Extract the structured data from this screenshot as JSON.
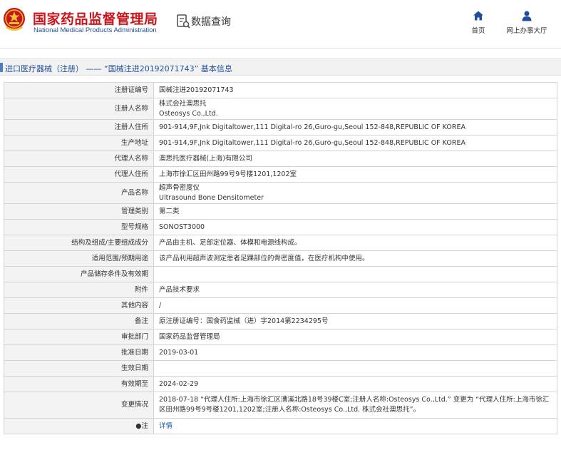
{
  "header": {
    "site_name_cn": "国家药品监督管理局",
    "site_name_en": "National Medical Products Administration",
    "section_label": "数据查询",
    "nav": [
      {
        "label": "首页",
        "icon": "home-icon"
      },
      {
        "label": "网上办事大厅",
        "icon": "user-icon"
      }
    ]
  },
  "page": {
    "title": "进口医疗器械（注册） —— “国械注进20192071743” 基本信息"
  },
  "details": [
    {
      "label": "注册证编号",
      "lines": [
        "国械注进20192071743"
      ]
    },
    {
      "label": "注册人名称",
      "lines": [
        "株式会社澳思托",
        "Osteosys Co.,Ltd."
      ]
    },
    {
      "label": "注册人住所",
      "lines": [
        "901-914,9F,Jnk Digitaltower,111 Digital-ro 26,Guro-gu,Seoul 152-848,REPUBLIC OF KOREA"
      ]
    },
    {
      "label": "生产地址",
      "lines": [
        "901-914,9F,Jnk Digitaltower,111 Digital-ro 26,Guro-gu,Seoul 152-848,REPUBLIC OF KOREA"
      ]
    },
    {
      "label": "代理人名称",
      "lines": [
        "澳思托医疗器械(上海)有限公司"
      ]
    },
    {
      "label": "代理人住所",
      "lines": [
        "上海市徐汇区田州路99号9号楼1201,1202室"
      ]
    },
    {
      "label": "产品名称",
      "lines": [
        "超声骨密度仪",
        "Ultrasound Bone Densitometer"
      ]
    },
    {
      "label": "管理类别",
      "lines": [
        "第二类"
      ]
    },
    {
      "label": "型号规格",
      "lines": [
        "SONOST3000"
      ]
    },
    {
      "label": "结构及组成/主要组成成分",
      "lines": [
        "产品由主机、足部定位器、体模和电源线构成。"
      ]
    },
    {
      "label": "适用范围/预期用途",
      "lines": [
        "该产品利用超声波测定患者足踝部位的骨密度值，在医疗机构中使用。"
      ]
    },
    {
      "label": "产品储存条件及有效期",
      "lines": [
        ""
      ]
    },
    {
      "label": "附件",
      "lines": [
        "产品技术要求"
      ]
    },
    {
      "label": "其他内容",
      "lines": [
        "/"
      ]
    },
    {
      "label": "备注",
      "lines": [
        "原注册证编号：国食药监械（进）字2014第2234295号"
      ]
    },
    {
      "label": "审批部门",
      "lines": [
        "国家药品监督管理局"
      ]
    },
    {
      "label": "批准日期",
      "lines": [
        "2019-03-01"
      ]
    },
    {
      "label": "生效日期",
      "lines": [
        ""
      ]
    },
    {
      "label": "有效期至",
      "lines": [
        "2024-02-29"
      ]
    },
    {
      "label": "变更情况",
      "paragraph": "2018-07-18 “代理人住所:上海市徐汇区漕溪北路18号39楼C室;注册人名称:Osteosys Co.,Ltd.” 变更为 “代理人住所:上海市徐汇区田州路99号9号楼1201,1202室;注册人名称:Osteosys Co.,Ltd. 株式会社澳思托”。"
    },
    {
      "label": "●注",
      "link": "详情"
    }
  ]
}
